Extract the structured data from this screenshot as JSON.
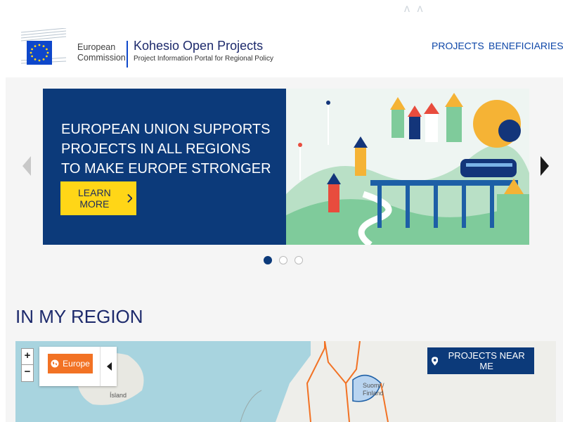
{
  "header": {
    "logo_line1": "European",
    "logo_line2": "Commission",
    "brand_title": "Kohesio Open Projects",
    "brand_subtitle": "Project Information Portal for Regional Policy",
    "watermark": "ʌ ʌ"
  },
  "nav": {
    "items": [
      {
        "label": "PROJECTS"
      },
      {
        "label": "BENEFICIARIES"
      }
    ]
  },
  "carousel": {
    "headline": "EUROPEAN UNION SUPPORTS PROJECTS IN ALL REGIONS TO MAKE EUROPE STRONGER",
    "cta_label": "LEARN MORE",
    "slide_count": 3,
    "active_index": 0
  },
  "region_section": {
    "title": "IN MY REGION"
  },
  "map": {
    "zoom_in": "+",
    "zoom_out": "−",
    "region_chip": "Europe",
    "projects_near_me": "PROJECTS NEAR ME",
    "labels": {
      "iceland": "Ísland",
      "finland_1": "Suomi /",
      "finland_2": "Finland"
    }
  },
  "colors": {
    "navy": "#0c3a7a",
    "yellow": "#ffd617",
    "orange": "#f27224",
    "nav_blue": "#0e47a8"
  }
}
